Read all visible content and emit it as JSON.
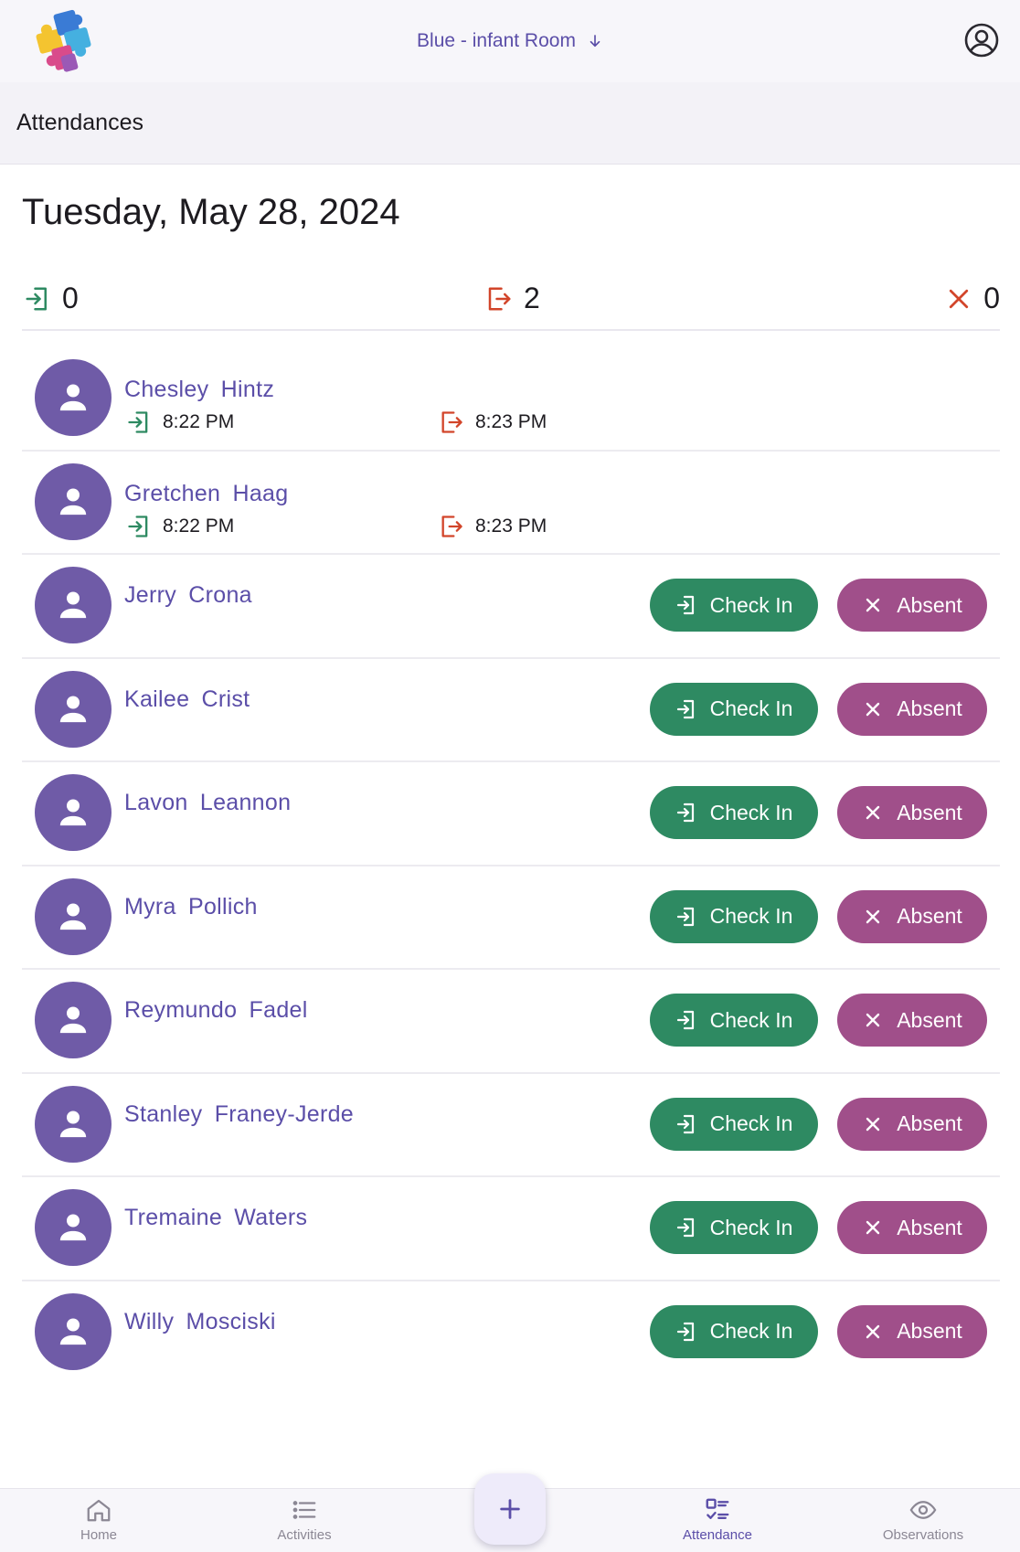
{
  "header": {
    "room_label": "Blue - infant Room"
  },
  "page": {
    "title": "Attendances",
    "date": "Tuesday, May 28, 2024"
  },
  "summary": {
    "checked_in": "0",
    "checked_out": "2",
    "absent": "0"
  },
  "buttons": {
    "check_in": "Check In",
    "absent": "Absent"
  },
  "children_done": [
    {
      "name": "Chesley Hintz",
      "check_in": "8:22 PM",
      "check_out": "8:23 PM"
    },
    {
      "name": "Gretchen Haag",
      "check_in": "8:22 PM",
      "check_out": "8:23 PM"
    }
  ],
  "children_pending": [
    {
      "name": "Jerry Crona"
    },
    {
      "name": "Kailee Crist"
    },
    {
      "name": "Lavon Leannon"
    },
    {
      "name": "Myra Pollich"
    },
    {
      "name": "Reymundo Fadel"
    },
    {
      "name": "Stanley Franey-Jerde"
    },
    {
      "name": "Tremaine Waters"
    },
    {
      "name": "Willy Mosciski"
    }
  ],
  "nav": {
    "home": "Home",
    "activities": "Activities",
    "attendance": "Attendance",
    "observations": "Observations",
    "active": "attendance"
  },
  "colors": {
    "accent": "#5b4ea8",
    "avatar": "#6f5ba7",
    "check_in": "#2e8a62",
    "check_out": "#d2452a",
    "absent": "#a04f8a"
  },
  "icons": {
    "logo": "puzzle-logo-icon",
    "room_dropdown": "arrow-down-icon",
    "account": "account-circle-icon",
    "check_in": "login-icon",
    "check_out": "logout-icon",
    "absent": "close-icon",
    "avatar": "person-icon",
    "fab": "plus-icon"
  }
}
